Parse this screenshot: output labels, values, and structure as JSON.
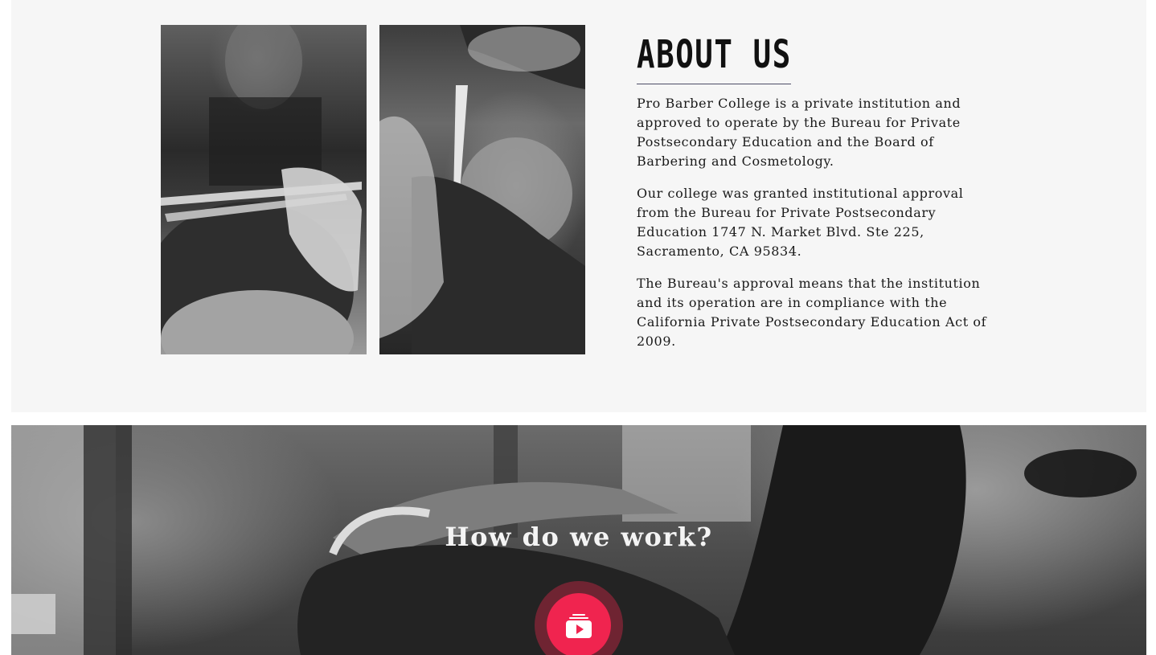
{
  "about": {
    "title": "ABOUT US",
    "paragraphs": [
      "Pro Barber College is a private institution and approved to operate by the Bureau for Private Postsecondary Education and the Board of Barbering and Cosmetology.",
      "Our college was granted institutional approval from the Bureau for Private Postsecondary Education 1747 N. Market Blvd. Ste 225, Sacramento, CA 95834.",
      "The Bureau's approval means that the institution and its operation are in compliance with the California Private Postsecondary Education Act of 2009."
    ],
    "images": [
      {
        "icon": "barber-cutting-hair-photo"
      },
      {
        "icon": "barber-shaving-neck-photo"
      }
    ]
  },
  "video": {
    "heading": "How do we work?",
    "play_icon": "youtube-play-icon",
    "accent_color": "#f0244f"
  }
}
